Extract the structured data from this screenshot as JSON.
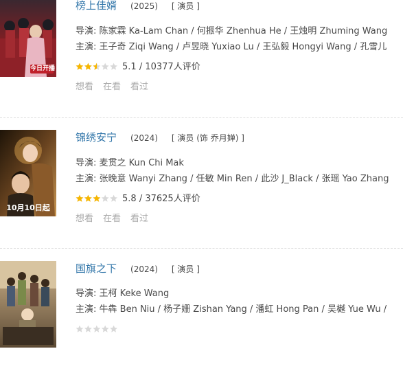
{
  "items": [
    {
      "title": "榜上佳婿",
      "year": "(2025)",
      "role": "[ 演员 ]",
      "director_label": "导演:",
      "director": "陈家霖 Ka-Lam Chan / 何振华 Zhenhua He / 王烛明 Zhuming Wang",
      "cast_label": "主演:",
      "cast": "王子奇 Ziqi Wang / 卢昱晓 Yuxiao Lu / 王弘毅 Hongyi Wang / 孔雪儿",
      "rating_stars": 2.5,
      "rating": "5.1",
      "rating_count": "10377人评价",
      "actions": [
        "想看",
        "在看",
        "看过"
      ],
      "poster_text": "今日开播",
      "poster_colors": [
        "#6b1c22",
        "#b23a3a"
      ]
    },
    {
      "title": "锦绣安宁",
      "year": "(2024)",
      "role": "[ 演员 (饰 乔月婵) ]",
      "director_label": "导演:",
      "director": "麦贯之 Kun Chi Mak",
      "cast_label": "主演:",
      "cast": "张晚意 Wanyi Zhang / 任敏 Min Ren / 此沙 J_Black / 张瑶 Yao Zhang",
      "rating_stars": 3,
      "rating": "5.8",
      "rating_count": "37625人评价",
      "actions": [
        "想看",
        "在看",
        "看过"
      ],
      "poster_text": "10月10日起",
      "poster_colors": [
        "#3a2410",
        "#a8743a"
      ]
    },
    {
      "title": "国旗之下",
      "year": "(2024)",
      "role": "[ 演员 ]",
      "director_label": "导演:",
      "director": "王柯 Keke Wang",
      "cast_label": "主演:",
      "cast": "牛犇 Ben Niu / 杨子姗 Zishan Yang / 潘虹 Hong Pan / 吴樾 Yue Wu /",
      "rating_stars": 0,
      "rating": "",
      "rating_count": "",
      "actions": [],
      "poster_text": "",
      "poster_colors": [
        "#5a4a36",
        "#b89a70"
      ]
    }
  ],
  "colors": {
    "link": "#3377aa",
    "star": "#f7b600",
    "star_empty": "#d8d8d8",
    "muted": "#aaaaaa"
  }
}
